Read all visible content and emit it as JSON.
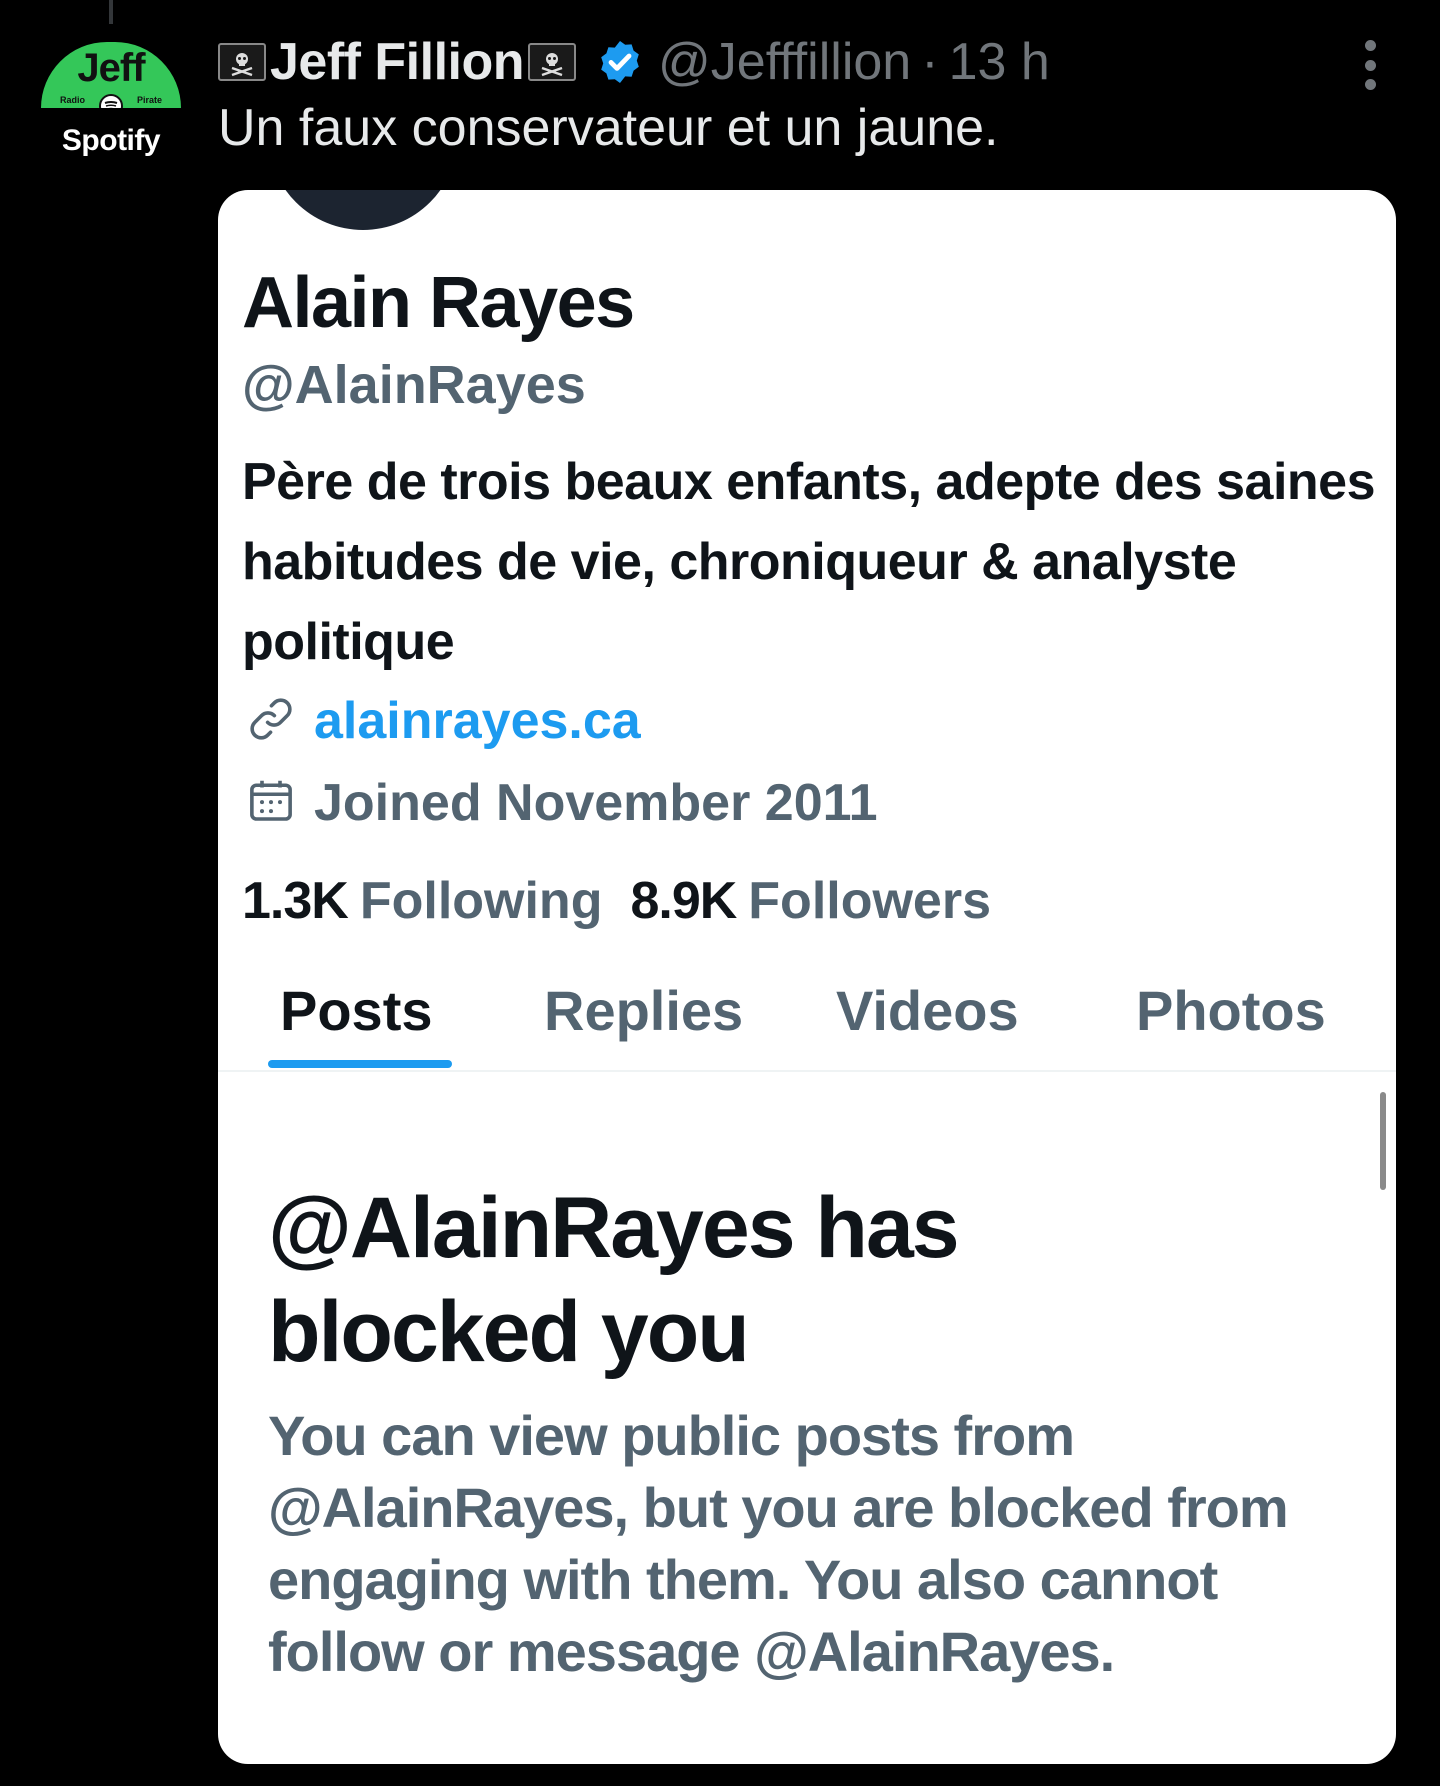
{
  "tweet": {
    "avatar": {
      "top_text": "Jeff",
      "left_small": "Radio",
      "right_small": "Pirate",
      "bottom_text": "Spotify"
    },
    "author_name": "Jeff Fillion",
    "handle": "@Jefffillion",
    "separator": "·",
    "time": "13 h",
    "text": "Un faux conservateur et un jaune.",
    "icons": [
      "pirate-flag-icon",
      "verified-badge-icon",
      "more-options-icon"
    ],
    "colors": {
      "verified": "#1d9bf0",
      "muted": "#71767b",
      "spotify_green": "#34c759"
    }
  },
  "embedded_profile": {
    "name": "Alain Rayes",
    "handle": "@AlainRayes",
    "bio": "Père de trois beaux enfants, adepte des saines habitudes de vie, chroniqueur & analyste politique",
    "link": "alainrayes.ca",
    "joined": "Joined November 2011",
    "following_count": "1.3K",
    "following_label": "Following",
    "followers_count": "8.9K",
    "followers_label": "Followers",
    "tabs": [
      "Posts",
      "Replies",
      "Videos",
      "Photos"
    ],
    "active_tab": "Posts",
    "blocked_title": "@AlainRayes has blocked you",
    "blocked_description": "You can view public posts from @AlainRayes, but you are blocked from engaging with them. You also cannot follow or message @AlainRayes.",
    "icons": [
      "link-icon",
      "calendar-icon"
    ],
    "colors": {
      "accent": "#1d9bf0",
      "secondary_text": "#536471"
    }
  }
}
